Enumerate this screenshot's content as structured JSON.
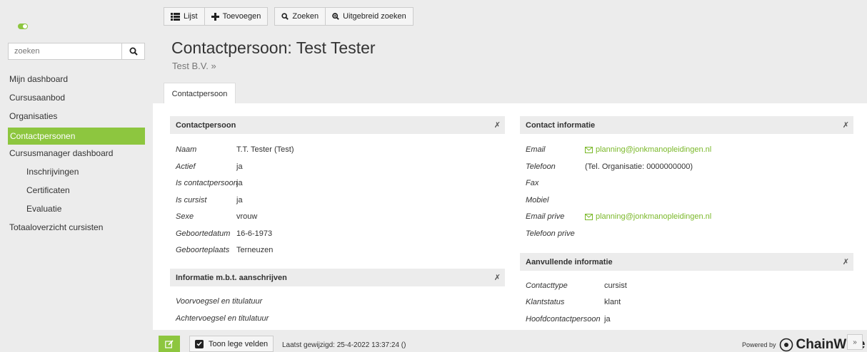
{
  "sidebar": {
    "search_placeholder": "zoeken",
    "items": [
      {
        "label": "Mijn dashboard"
      },
      {
        "label": "Cursusaanbod"
      },
      {
        "label": "Organisaties"
      },
      {
        "label": "Contactpersonen",
        "active": true
      },
      {
        "label": "Cursusmanager dashboard"
      },
      {
        "label": "Inschrijvingen",
        "sub": true
      },
      {
        "label": "Certificaten",
        "sub": true
      },
      {
        "label": "Evaluatie",
        "sub": true
      },
      {
        "label": "Totaaloverzicht cursisten"
      }
    ]
  },
  "toolbar": {
    "list_label": "Lijst",
    "add_label": "Toevoegen",
    "search_label": "Zoeken",
    "advanced_search_label": "Uitgebreid zoeken"
  },
  "header": {
    "title": "Contactpersoon: Test Tester",
    "organization": "Test B.V. »",
    "tab": "Contactpersoon"
  },
  "panels": {
    "contact": {
      "title": "Contactpersoon",
      "rows": [
        {
          "label": "Naam",
          "value": "T.T. Tester (Test)"
        },
        {
          "label": "Actief",
          "value": "ja"
        },
        {
          "label": "Is contactpersoon",
          "value": "ja"
        },
        {
          "label": "Is cursist",
          "value": "ja"
        },
        {
          "label": "Sexe",
          "value": "vrouw"
        },
        {
          "label": "Geboortedatum",
          "value": "16-6-1973"
        },
        {
          "label": "Geboorteplaats",
          "value": "Terneuzen"
        }
      ]
    },
    "mailing": {
      "title": "Informatie m.b.t. aanschrijven",
      "rows": [
        {
          "label": "Voorvoegsel en titulatuur",
          "value": ""
        },
        {
          "label": "Achtervoegsel en titulatuur",
          "value": ""
        }
      ]
    },
    "contact_info": {
      "title": "Contact informatie",
      "rows": [
        {
          "label": "Email",
          "value": "planning@jonkmanopleidingen.nl"
        },
        {
          "label": "Telefoon",
          "value": "(Tel. Organisatie: 0000000000)"
        },
        {
          "label": "Fax",
          "value": ""
        },
        {
          "label": "Mobiel",
          "value": ""
        },
        {
          "label": "Email prive",
          "value": "planning@jonkmanopleidingen.nl"
        },
        {
          "label": "Telefoon prive",
          "value": ""
        }
      ]
    },
    "extra_info": {
      "title": "Aanvullende informatie",
      "rows": [
        {
          "label": "Contacttype",
          "value": "cursist"
        },
        {
          "label": "Klantstatus",
          "value": "klant"
        },
        {
          "label": "Hoofdcontactpersoon",
          "value": "ja"
        }
      ]
    }
  },
  "bottom": {
    "toon_label": "Toon lege velden",
    "modified": "Laatst gewijzigd: 25-4-2022 13:37:24 ()",
    "powered_by": "Powered by",
    "brand": "ChainWise",
    "collapse": "»"
  },
  "colors": {
    "accent": "#8dc63f",
    "link": "#7ab829",
    "panel_header": "#ececec"
  }
}
